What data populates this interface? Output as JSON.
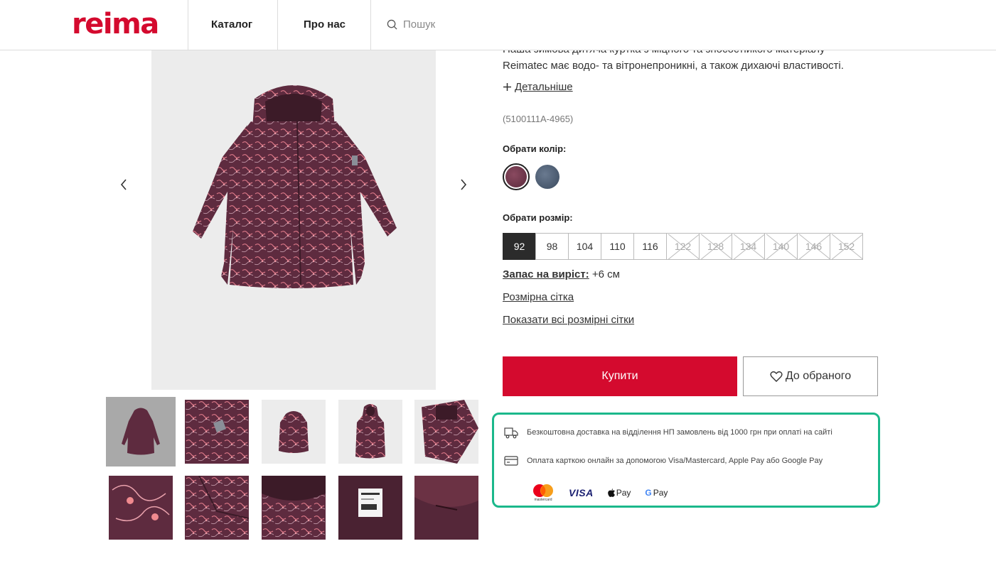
{
  "header": {
    "logo": "reima",
    "nav": [
      "Каталог",
      "Про нас"
    ],
    "search_placeholder": "Пошук"
  },
  "product": {
    "description_line1": "Наша зимова дитяча куртка з міцного та зносостійкого матеріалу",
    "description_line2": "Reimatec має водо- та вітронепроникні, а також дихаючі властивості.",
    "details_link": "Детальніше",
    "sku": "(5100111A-4965)",
    "color_label": "Обрати колір:",
    "colors": [
      {
        "name": "burgundy",
        "hex": "#6a3448",
        "selected": true
      },
      {
        "name": "navy",
        "hex": "#4a5a6e",
        "selected": false
      }
    ],
    "size_label": "Обрати розмір:",
    "sizes": [
      {
        "label": "92",
        "state": "selected"
      },
      {
        "label": "98",
        "state": "available"
      },
      {
        "label": "104",
        "state": "available"
      },
      {
        "label": "110",
        "state": "available"
      },
      {
        "label": "116",
        "state": "available"
      },
      {
        "label": "122",
        "state": "unavailable"
      },
      {
        "label": "128",
        "state": "unavailable"
      },
      {
        "label": "134",
        "state": "unavailable"
      },
      {
        "label": "140",
        "state": "unavailable"
      },
      {
        "label": "146",
        "state": "unavailable"
      },
      {
        "label": "152",
        "state": "unavailable"
      }
    ],
    "growth_label": "Запас на виріст:",
    "growth_value": "+6 см",
    "size_chart_link": "Розмірна сітка",
    "all_size_charts_link": "Показати всі розмірні сітки",
    "buy_button": "Купити",
    "favorite_button": "До обраного"
  },
  "info": {
    "delivery": "Безкоштовна доставка на відділення НП замовлень від 1000 грн при оплаті на сайті",
    "payment": "Оплата карткою онлайн за допомогою Visa/Mastercard, Apple Pay або Google Pay",
    "logos": {
      "mastercard": "mastercard",
      "visa": "VISA",
      "applepay": "Pay",
      "gpay_g": "G",
      "gpay": "Pay"
    }
  },
  "colors": {
    "brand_red": "#d40a2e",
    "info_border": "#1bb88b",
    "selected_size_bg": "#2b2b2b",
    "jacket": "#5e2b3f",
    "jacket_pattern": "#e07a8a"
  }
}
